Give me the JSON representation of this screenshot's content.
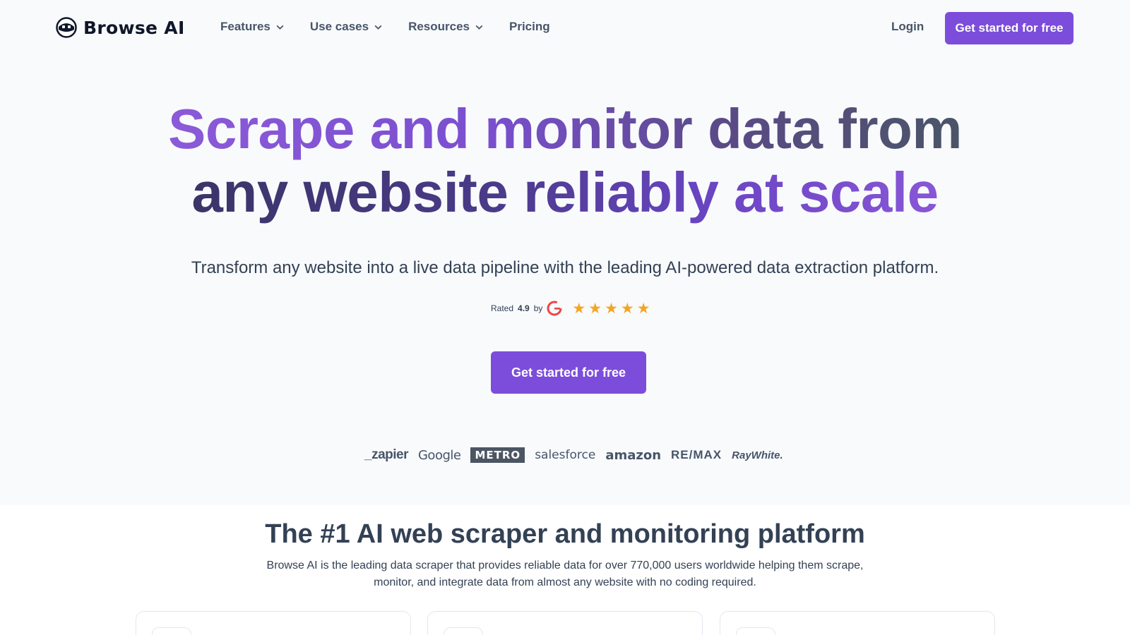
{
  "nav": {
    "logo_text": "Browse AI",
    "menu": [
      {
        "label": "Features",
        "has_dropdown": true
      },
      {
        "label": "Use cases",
        "has_dropdown": true
      },
      {
        "label": "Resources",
        "has_dropdown": true
      },
      {
        "label": "Pricing",
        "has_dropdown": false
      }
    ],
    "login": "Login",
    "cta": "Get started for free"
  },
  "hero": {
    "title_line1_a": "Scrape and monitor data from",
    "title_line2_a": "any website reliably at scale",
    "subtitle": "Transform any website into a live data pipeline with the leading AI-powered data extraction platform.",
    "rating_prefix": "Rated",
    "rating_value": "4.9",
    "rating_suffix": "by",
    "rating_source_icon": "g2-icon",
    "stars": 5,
    "cta": "Get started for free"
  },
  "brands": [
    "_zapier",
    "Google",
    "METRO",
    "salesforce",
    "amazon",
    "RE/MAX",
    "RayWhite."
  ],
  "section": {
    "title": "The #1 AI web scraper and monitoring platform",
    "description": "Browse AI is the leading data scraper that provides reliable data for over 770,000 users worldwide helping them scrape, monitor, and integrate data from almost any website with no coding required."
  },
  "colors": {
    "accent": "#7c4ddb",
    "star": "#f5a524",
    "text": "#334155",
    "background": "#f8fafc"
  }
}
